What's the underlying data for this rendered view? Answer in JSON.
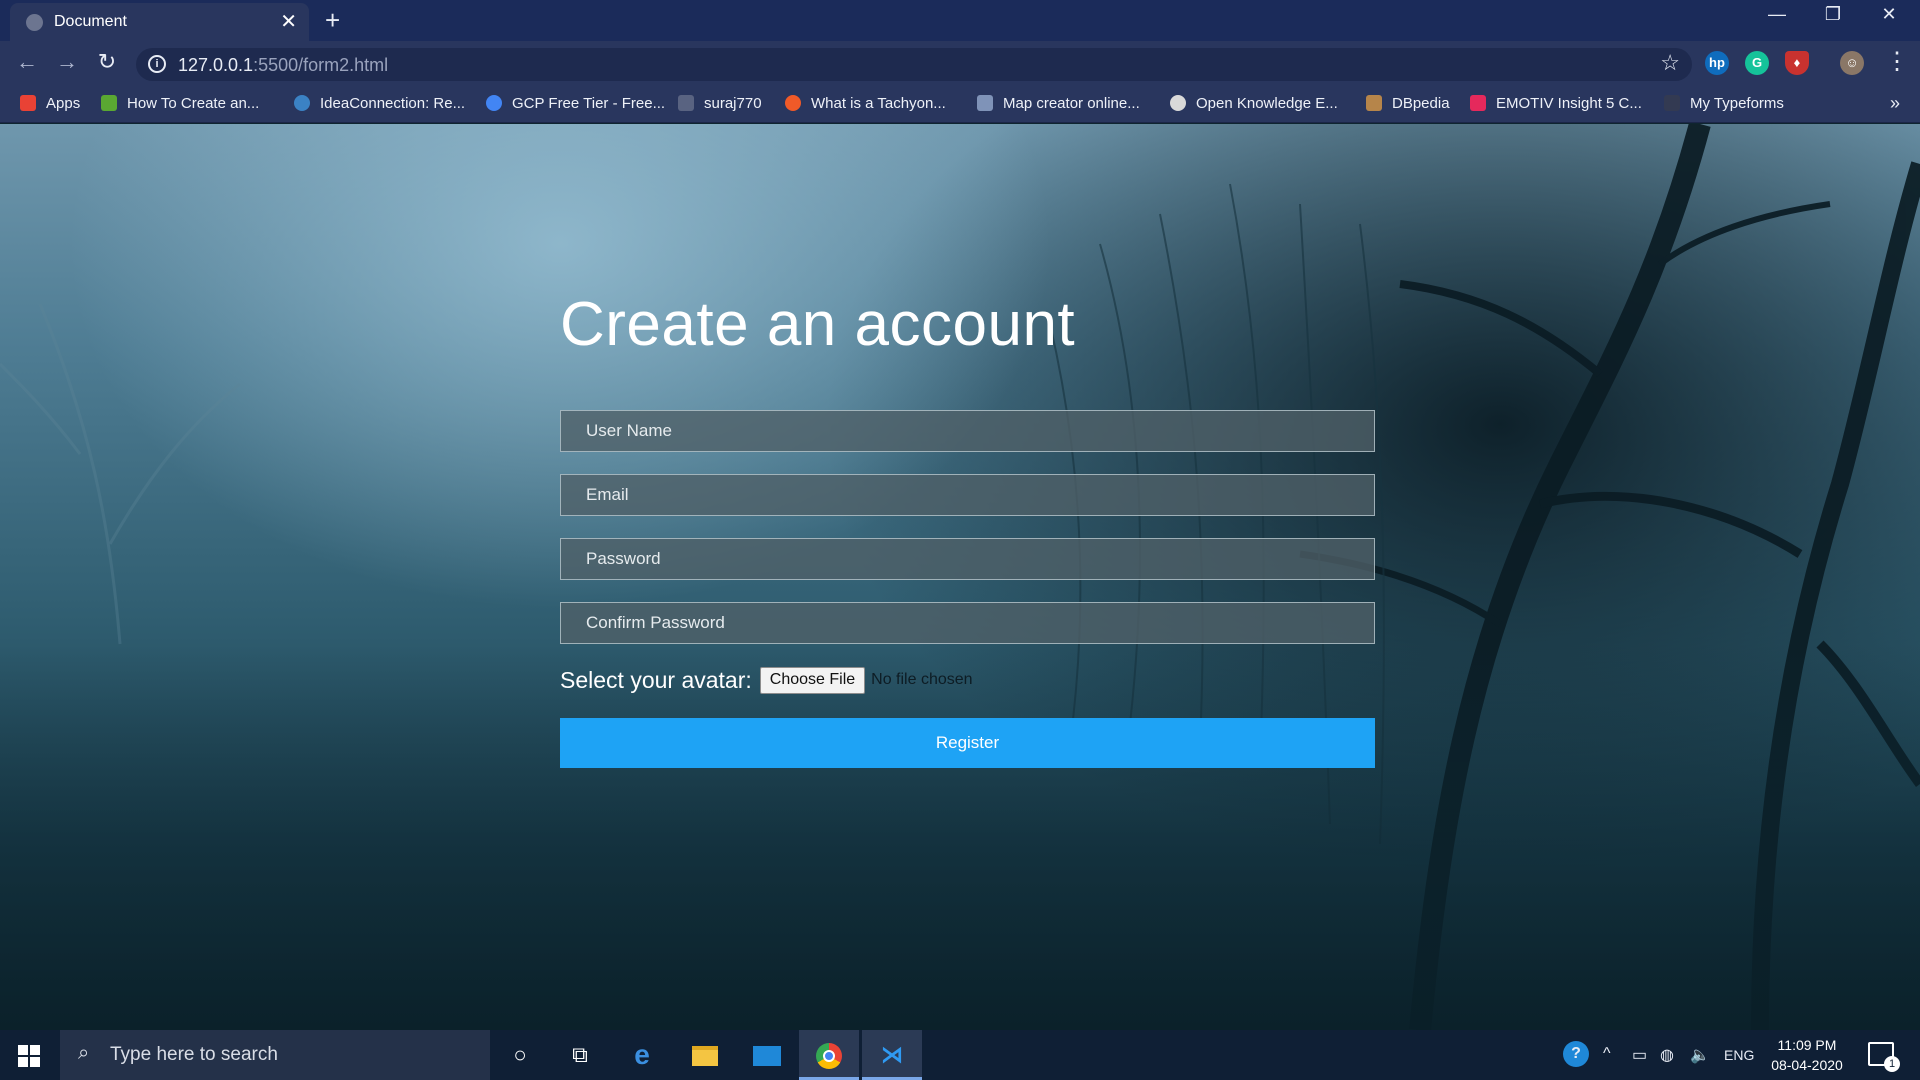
{
  "browser": {
    "tab_title": "Document",
    "url_host": "127.0.0.1",
    "url_rest": ":5500/form2.html",
    "bookmarks": [
      {
        "label": "Apps",
        "icon": "apps-grid-icon",
        "color": "#e94235"
      },
      {
        "label": "How To Create an...",
        "icon": "code-icon",
        "color": "#5aa832"
      },
      {
        "label": "IdeaConnection: Re...",
        "icon": "ideaconnection-icon",
        "color": "#3b82c4"
      },
      {
        "label": "GCP Free Tier - Free...",
        "icon": "google-cloud-icon",
        "color": "#4285f4"
      },
      {
        "label": "suraj770",
        "icon": "dots-icon",
        "color": "#8a8fa3"
      },
      {
        "label": "What is a Tachyon...",
        "icon": "tachyon-icon",
        "color": "#f05a28"
      },
      {
        "label": "Map creator online...",
        "icon": "zeemaps-icon",
        "color": "#7f93b8"
      },
      {
        "label": "Open Knowledge E...",
        "icon": "globe-icon",
        "color": "#d9d9d9"
      },
      {
        "label": "DBpedia",
        "icon": "dbpedia-icon",
        "color": "#f2a641"
      },
      {
        "label": "EMOTIV Insight 5 C...",
        "icon": "emotiv-icon",
        "color": "#e5295c"
      },
      {
        "label": "My Typeforms",
        "icon": "typeform-icon",
        "color": "#333a52"
      }
    ]
  },
  "form": {
    "title": "Create an account",
    "username_placeholder": "User Name",
    "email_placeholder": "Email",
    "password_placeholder": "Password",
    "confirm_placeholder": "Confirm Password",
    "avatar_label": "Select your avatar:",
    "choose_file": "Choose File",
    "no_file": "No file chosen",
    "register": "Register"
  },
  "taskbar": {
    "search_placeholder": "Type here to search",
    "language": "ENG",
    "time": "11:09 PM",
    "date": "08-04-2020",
    "notification_count": "1"
  }
}
